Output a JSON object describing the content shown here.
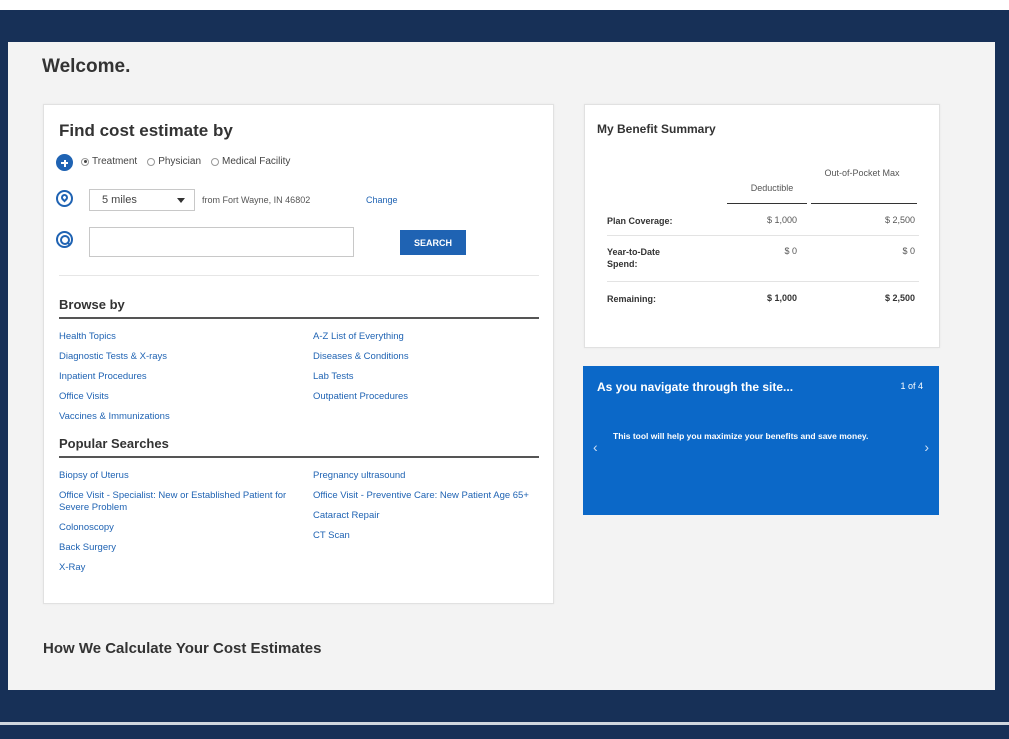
{
  "page": {
    "welcome": "Welcome."
  },
  "find": {
    "title": "Find cost estimate by",
    "radios": [
      {
        "label": "Treatment",
        "checked": true
      },
      {
        "label": "Physician",
        "checked": false
      },
      {
        "label": "Medical Facility",
        "checked": false
      }
    ],
    "distance": "5 miles",
    "from_text": "from Fort Wayne, IN 46802",
    "change_label": "Change",
    "search_placeholder": "",
    "search_label": "SEARCH",
    "icons": [
      "plus-icon",
      "location-pin-icon",
      "search-icon"
    ]
  },
  "browse": {
    "title": "Browse by",
    "left": [
      "Health Topics",
      "Diagnostic Tests & X-rays",
      "Inpatient Procedures",
      "Office Visits",
      "Vaccines & Immunizations"
    ],
    "right": [
      "A-Z List of Everything",
      "Diseases & Conditions",
      "Lab Tests",
      "Outpatient Procedures"
    ]
  },
  "popular": {
    "title": "Popular Searches",
    "left": [
      "Biopsy of Uterus",
      "Office Visit - Specialist: New or Established Patient for Severe Problem",
      "Colonoscopy",
      "Back Surgery",
      "X-Ray"
    ],
    "right": [
      "Pregnancy ultrasound",
      "Office Visit - Preventive Care: New Patient Age 65+",
      "Cataract Repair",
      "CT Scan"
    ]
  },
  "benefit": {
    "title": "My Benefit Summary",
    "columns": [
      "Deductible",
      "Out-of-Pocket Max"
    ],
    "rows": [
      {
        "label": "Plan Coverage:",
        "deductible": "$ 1,000",
        "oop": "$ 2,500"
      },
      {
        "label": "Year-to-Date Spend:",
        "deductible": "$ 0",
        "oop": "$ 0"
      },
      {
        "label": "Remaining:",
        "deductible": "$ 1,000",
        "oop": "$ 2,500"
      }
    ]
  },
  "navigate": {
    "title": "As you navigate through the site...",
    "count": "1 of 4",
    "body": "This tool will help you maximize your benefits and save money.",
    "prev": "‹",
    "next": "›"
  },
  "footer": {
    "calc_link": "How We Calculate Your Cost Estimates"
  },
  "colors": {
    "brand_navy": "#173057",
    "accent_blue": "#1f63b3",
    "banner_blue": "#0b68c8"
  }
}
